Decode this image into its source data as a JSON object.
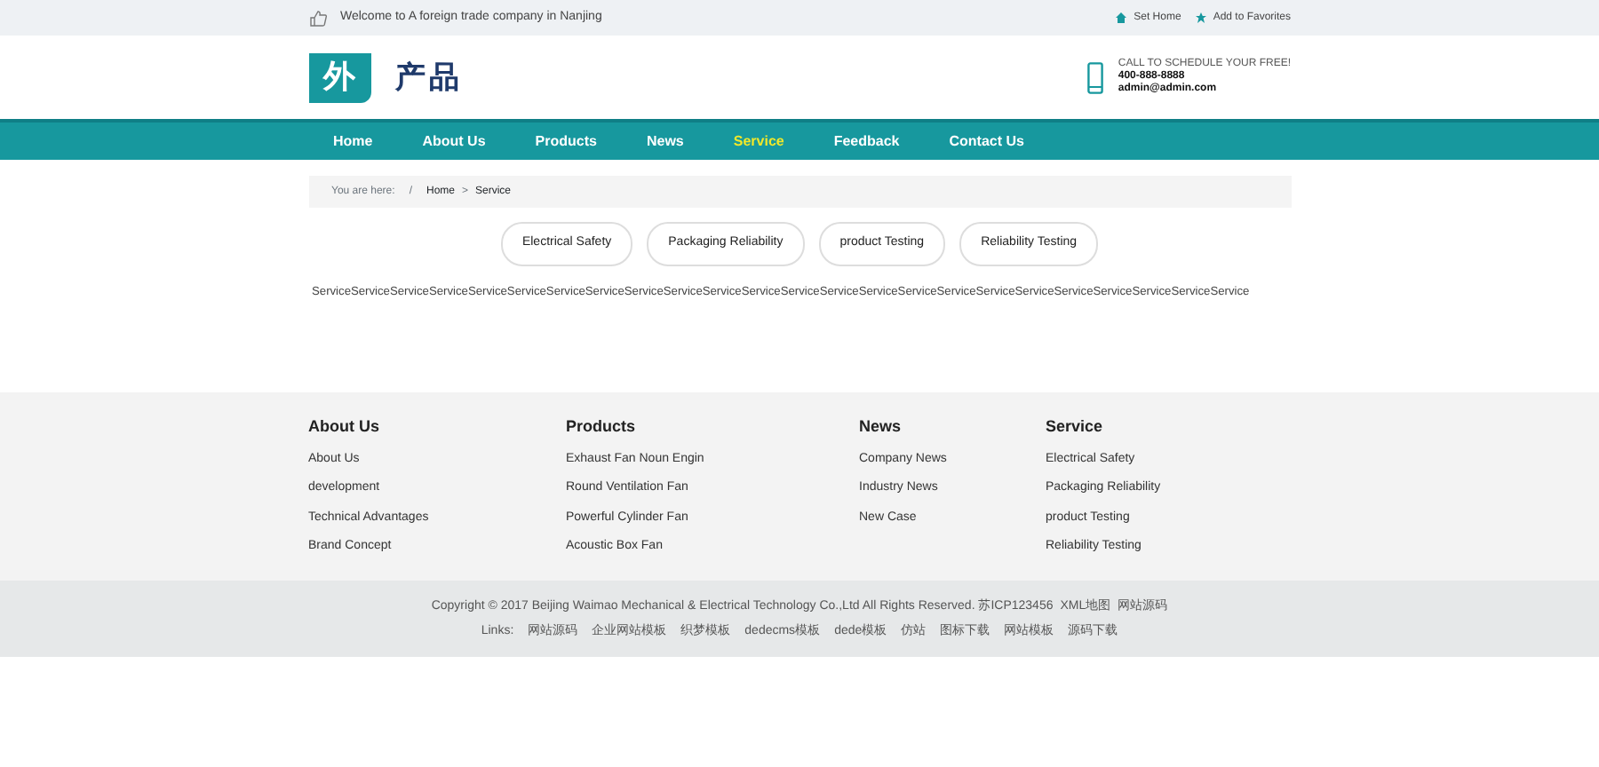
{
  "top_bar": {
    "welcome": "Welcome to A foreign trade company in Nanjing",
    "links": [
      {
        "kind": "home",
        "label": "Set Home"
      },
      {
        "kind": "star",
        "label": "Add to Favorites"
      }
    ]
  },
  "header": {
    "logo_mark": "外",
    "logo_text": "产品",
    "contact_caption": "CALL TO SCHEDULE YOUR FREE!",
    "phone": "400-888-8888",
    "email": "admin@admin.com"
  },
  "nav": [
    {
      "label": "Home",
      "selected": false
    },
    {
      "label": "About Us",
      "selected": false
    },
    {
      "label": "Products",
      "selected": false
    },
    {
      "label": "News",
      "selected": false
    },
    {
      "label": "Service",
      "selected": true
    },
    {
      "label": "Feedback",
      "selected": false
    },
    {
      "label": "Contact Us",
      "selected": false
    }
  ],
  "breadcrumb": {
    "prefix": "You are here:",
    "separator": "/",
    "items": [
      "Home",
      "Service"
    ],
    "arrow": ">"
  },
  "categories": [
    "Electrical Safety",
    "Packaging Reliability",
    "product Testing",
    "Reliability Testing"
  ],
  "content": "ServiceServiceServiceServiceServiceServiceServiceServiceServiceServiceServiceServiceServiceServiceServiceServiceServiceServiceServiceServiceServiceServiceServiceService",
  "footer_columns": [
    {
      "title": "About Us",
      "links": [
        "About Us",
        "development",
        "Technical Advantages",
        "Brand Concept"
      ]
    },
    {
      "title": "Products",
      "links": [
        "Exhaust Fan Noun Engin",
        "Round Ventilation Fan",
        "Powerful Cylinder Fan",
        "Acoustic Box Fan"
      ]
    },
    {
      "title": "News",
      "links": [
        "Company News",
        "Industry News",
        "New Case"
      ]
    },
    {
      "title": "Service",
      "links": [
        "Electrical Safety",
        "Packaging Reliability",
        "product Testing",
        "Reliability Testing"
      ]
    }
  ],
  "copyright": {
    "text": "Copyright © 2017 Beijing Waimao Mechanical & Electrical Technology Co.,Ltd All Rights Reserved. 苏ICP123456",
    "links": [
      "XML地图",
      "网站源码"
    ]
  },
  "friend_links": {
    "label": "Links:",
    "items": [
      "网站源码",
      "企业网站模板",
      "织梦模板",
      "dedecms模板",
      "dede模板",
      "仿站",
      "图标下载",
      "网站模板",
      "源码下载"
    ]
  }
}
